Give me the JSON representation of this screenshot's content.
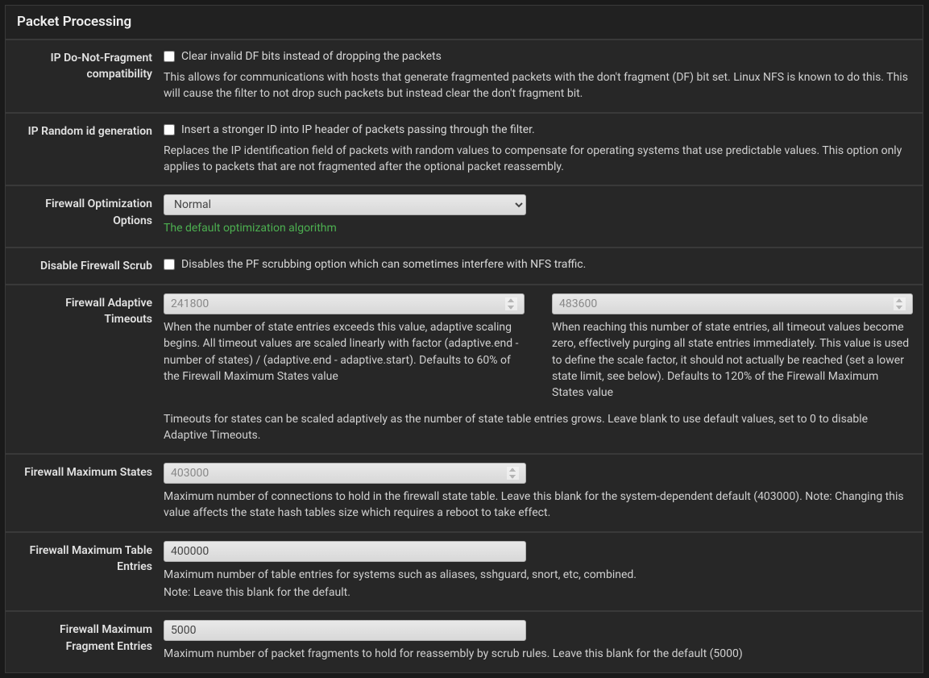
{
  "panel_title": "Packet Processing",
  "dfcompat": {
    "label": "IP Do-Not-Fragment compatibility",
    "checkbox_label": "Clear invalid DF bits instead of dropping the packets",
    "help": "This allows for communications with hosts that generate fragmented packets with the don't fragment (DF) bit set. Linux NFS is known to do this. This will cause the filter to not drop such packets but instead clear the don't fragment bit."
  },
  "randomid": {
    "label": "IP Random id generation",
    "checkbox_label": "Insert a stronger ID into IP header of packets passing through the filter.",
    "help": "Replaces the IP identification field of packets with random values to compensate for operating systems that use predictable values. This option only applies to packets that are not fragmented after the optional packet reassembly."
  },
  "optimization": {
    "label": "Firewall Optimization Options",
    "selected": "Normal",
    "help_green": "The default optimization algorithm"
  },
  "scrub": {
    "label": "Disable Firewall Scrub",
    "checkbox_label": "Disables the PF scrubbing option which can sometimes interfere with NFS traffic."
  },
  "adaptive": {
    "label": "Firewall Adaptive Timeouts",
    "start_placeholder": "241800",
    "start_help": "When the number of state entries exceeds this value, adaptive scaling begins. All timeout values are scaled linearly with factor (adaptive.end - number of states) / (adaptive.end - adaptive.start). Defaults to 60% of the Firewall Maximum States value",
    "end_placeholder": "483600",
    "end_help": "When reaching this number of state entries, all timeout values become zero, effectively purging all state entries immediately. This value is used to define the scale factor, it should not actually be reached (set a lower state limit, see below). Defaults to 120% of the Firewall Maximum States value",
    "footer": "Timeouts for states can be scaled adaptively as the number of state table entries grows. Leave blank to use default values, set to 0 to disable Adaptive Timeouts."
  },
  "maxstates": {
    "label": "Firewall Maximum States",
    "placeholder": "403000",
    "help": "Maximum number of connections to hold in the firewall state table. Leave this blank for the system-dependent default (403000). Note: Changing this value affects the state hash tables size which requires a reboot to take effect."
  },
  "maxtable": {
    "label": "Firewall Maximum Table Entries",
    "value": "400000",
    "help1": "Maximum number of table entries for systems such as aliases, sshguard, snort, etc, combined.",
    "help2": "Note: Leave this blank for the default."
  },
  "maxfrag": {
    "label": "Firewall Maximum Fragment Entries",
    "value": "5000",
    "help": "Maximum number of packet fragments to hold for reassembly by scrub rules. Leave this blank for the default (5000)"
  }
}
